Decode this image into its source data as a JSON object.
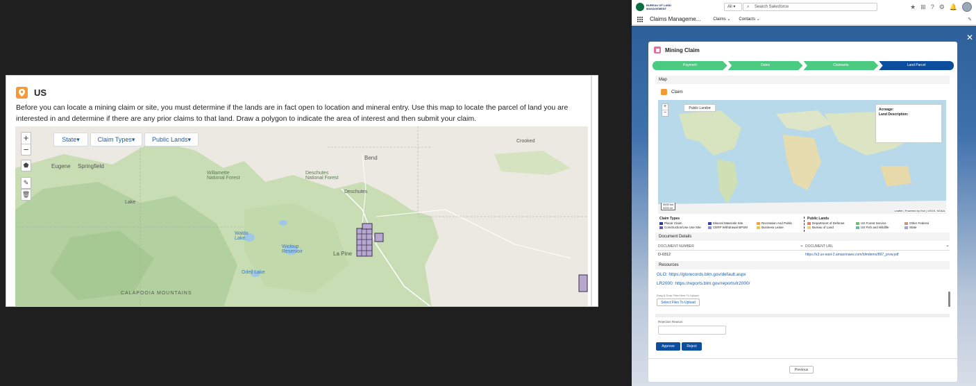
{
  "left": {
    "title": "US",
    "description": "Before you can locate a mining claim or site, you must determine if the lands are in fact open to location and mineral entry. Use this map to locate the parcel of land you are interested in and determine if there are any prior claims to that land. Draw a polygon to indicate the area of interest and then submit your claim.",
    "map": {
      "zoom_in": "+",
      "zoom_out": "−",
      "filters": [
        "State",
        "Claim Types",
        "Public Lands"
      ],
      "place_labels": [
        "Eugene",
        "Springfield",
        "Bend",
        "Deschutes",
        "La Pine",
        "Willamette National Forest",
        "Deschutes National Forest",
        "Wickiup Reservoir",
        "Odell Lake",
        "Waldo Lake",
        "CALAPOOIA MOUNTAINS",
        "Crooked",
        "Lake"
      ]
    }
  },
  "sf": {
    "org_name": "BUREAU OF LAND MANAGEMENT",
    "scope": "All",
    "search_placeholder": "Search Salesforce",
    "app_name": "Claims Manageme...",
    "nav": [
      "Claims",
      "Contacts"
    ],
    "modal": {
      "title": "Mining Claim",
      "path_steps": [
        "Payment",
        "Dates",
        "Claimants",
        "Land Parcel"
      ],
      "current_step": "Land Parcel",
      "map_section": "Map",
      "claim_label": "Claim",
      "public_lands_btn": "Public Lands",
      "acreage_label": "Acreage:",
      "land_desc_label": "Land Description:",
      "scale_top": "3000 km",
      "scale_bottom": "3000 mi",
      "attribution": "Leaflet | Powered by Esri | USGS, NOAA",
      "legend": {
        "claim_types_title": "Claim Types",
        "public_lands_title": "Public Lands",
        "claim_types": [
          {
            "label": "Placer Claim",
            "color": "#2f3b8a"
          },
          {
            "label": "Mineral Materials Site",
            "color": "#3a3fa1"
          },
          {
            "label": "Recreation And Public",
            "color": "#f0a050"
          },
          {
            "label": "Construction/Use Use Site",
            "color": "#6b5ba6"
          },
          {
            "label": "CERP Withdrawal BPSM",
            "color": "#8c8fc9"
          },
          {
            "label": "Business Lease",
            "color": "#e8c35c"
          }
        ],
        "public_lands": [
          {
            "label": "Department of Defense",
            "color": "#e77f61"
          },
          {
            "label": "US Forest Service",
            "color": "#6fbf73"
          },
          {
            "label": "Other Federal",
            "color": "#c79a7a"
          },
          {
            "label": "Bureau of Land",
            "color": "#f2d26b"
          },
          {
            "label": "US Fish and Wildlife",
            "color": "#5bbfa6"
          },
          {
            "label": "State",
            "color": "#a5a0d4"
          }
        ]
      },
      "doc_section": "Document Details",
      "doc_headers": [
        "DOCUMENT NUMBER",
        "DOCUMENT URL"
      ],
      "doc_row": {
        "number": "D-0312",
        "url": "https://s3.us-east-2.amazonaws.com/blmdemo/897_prvw.pdf"
      },
      "resources_section": "Resources",
      "resources": [
        "GLO: https://glorecords.blm.gov/default.aspx",
        "LR2000: https://reports.blm.gov/reports/lr2000/"
      ],
      "upload_hint": "Drag & Drop Files Here To Upload",
      "upload_btn": "Select Files To Upload",
      "rejection_label": "Rejection Reason",
      "approve": "Approve",
      "reject": "Reject",
      "previous": "Previous"
    }
  }
}
